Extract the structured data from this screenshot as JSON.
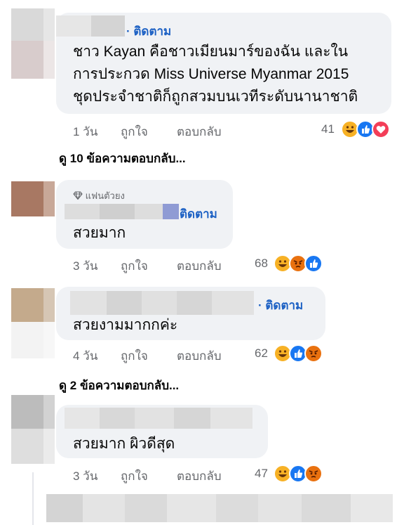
{
  "comments": [
    {
      "follow_label": "· ติดตาม",
      "text_lines": [
        "ชาว Kayan คือชาวเมียนมาร์ของฉัน และใน",
        "การประกวด Miss Universe Myanmar 2015",
        "ชุดประจำชาติก็ถูกสวมบนเวทีระดับนานาชาติ"
      ],
      "time": "1 วัน",
      "like_label": "ถูกใจ",
      "reply_label": "ตอบกลับ",
      "reaction_count": "41",
      "reactions": [
        "haha-icon",
        "like-icon",
        "love-icon"
      ],
      "view_replies": "ดู 10 ข้อความตอบกลับ..."
    },
    {
      "badge": "แฟนตัวยง",
      "follow_label": "ติดตาม",
      "text_lines": [
        "สวยมาก"
      ],
      "time": "3 วัน",
      "like_label": "ถูกใจ",
      "reply_label": "ตอบกลับ",
      "reaction_count": "68",
      "reactions": [
        "haha-icon",
        "angry-icon",
        "like-icon"
      ]
    },
    {
      "follow_label": "· ติดตาม",
      "text_lines": [
        "สวยงามมากกค่ะ"
      ],
      "time": "4 วัน",
      "like_label": "ถูกใจ",
      "reply_label": "ตอบกลับ",
      "reaction_count": "62",
      "reactions": [
        "haha-icon",
        "like-icon",
        "angry-icon"
      ],
      "view_replies": "ดู 2 ข้อความตอบกลับ..."
    },
    {
      "text_lines": [
        "สวยมาก ผิวดีสุด"
      ],
      "time": "3 วัน",
      "like_label": "ถูกใจ",
      "reply_label": "ตอบกลับ",
      "reaction_count": "47",
      "reactions": [
        "haha-icon",
        "like-icon",
        "angry-icon"
      ]
    }
  ],
  "colors": {
    "link_blue": "#1d61c4",
    "bubble_bg": "#f0f2f5",
    "meta_gray": "#65676b",
    "like_blue": "#1877f2",
    "love_red": "#f33e58",
    "angry_orange": "#e9710f",
    "haha_yellow": "#f7b125"
  }
}
